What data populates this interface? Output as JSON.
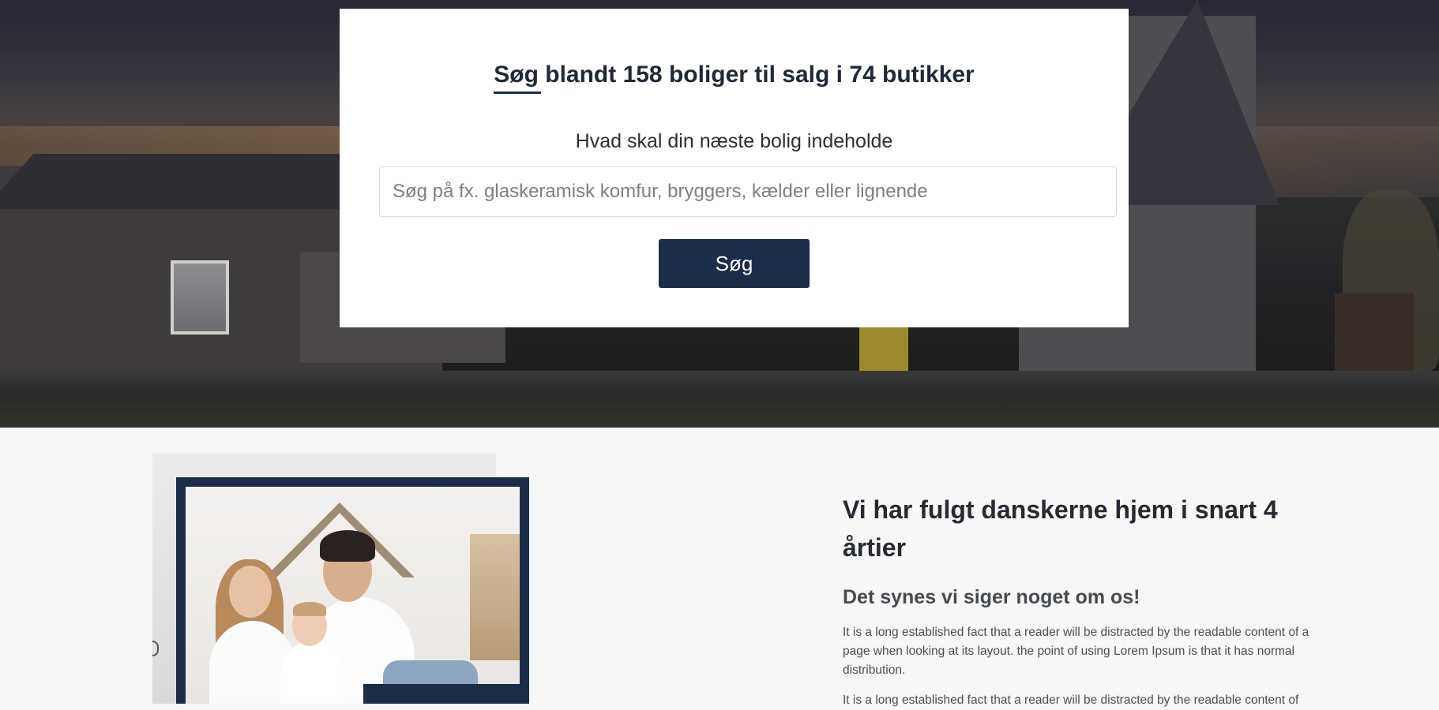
{
  "search": {
    "title": "Søg blandt 158 boliger til salg i 74 butikker",
    "subtitle": "Hvad skal din næste bolig indeholde",
    "placeholder": "Søg på fx. glaskeramisk komfur, bryggers, kælder eller lignende",
    "button_label": "Søg"
  },
  "about": {
    "heading": "Vi har fulgt danskerne hjem i snart 4 årtier",
    "subheading": "Det synes vi siger noget om os!",
    "paragraphs": [
      "It is a long established fact that a reader will be distracted by the readable content of a page when looking at its layout. the point of using Lorem Ipsum is that it has normal distribution.",
      "It is a long established fact that a reader will be distracted by the readable content of"
    ]
  },
  "colors": {
    "accent": "#1b2d48",
    "page_background": "#f7f7f7"
  }
}
